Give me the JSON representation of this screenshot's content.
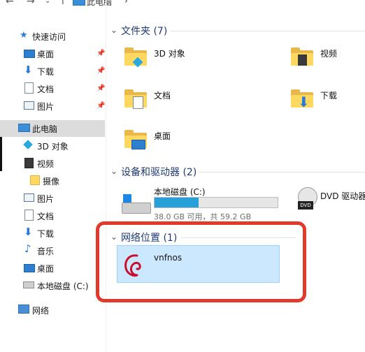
{
  "breadcrumb": {
    "root_label": "此电脑",
    "separator": "›"
  },
  "nav": {
    "quick_access": "快速访问",
    "items": [
      {
        "label": "桌面",
        "pinned": true
      },
      {
        "label": "下载",
        "pinned": true
      },
      {
        "label": "文档",
        "pinned": true
      },
      {
        "label": "图片",
        "pinned": true
      },
      {
        "label": "此电脑",
        "selected": true
      },
      {
        "label": "3D 对象"
      },
      {
        "label": "视频"
      },
      {
        "label": "摄像"
      },
      {
        "label": "图片"
      },
      {
        "label": "文档"
      },
      {
        "label": "下载"
      },
      {
        "label": "音乐"
      },
      {
        "label": "桌面"
      },
      {
        "label": "本地磁盘 (C:)"
      },
      {
        "label": "网络"
      }
    ]
  },
  "groups": {
    "folders": {
      "title": "文件夹 (7)"
    },
    "devices": {
      "title": "设备和驱动器 (2)"
    },
    "network": {
      "title": "网络位置 (1)"
    }
  },
  "folders": [
    {
      "label": "3D 对象"
    },
    {
      "label": "视频"
    },
    {
      "label": "文档"
    },
    {
      "label": "下载"
    },
    {
      "label": "桌面"
    }
  ],
  "drives": {
    "c": {
      "label": "本地磁盘 (C:)",
      "space": "38.0 GB 可用，共 59.2 GB",
      "used_fraction": 0.358
    },
    "dvd": {
      "label": "DVD 驱动器"
    }
  },
  "network_locations": [
    {
      "label": "vnfnos"
    }
  ],
  "colors": {
    "accent": "#26a0da",
    "selection": "#cce8ff",
    "highlight_box": "#e1392b",
    "header_text": "#1e3a70"
  }
}
